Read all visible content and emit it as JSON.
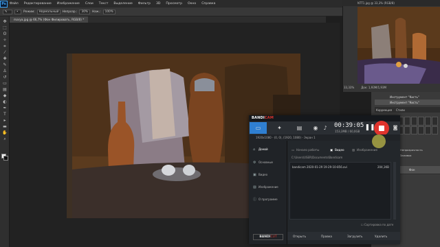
{
  "photoshop": {
    "logo": "Ps",
    "menu": [
      "Файл",
      "Редактирование",
      "Изображение",
      "Слои",
      "Текст",
      "Выделение",
      "Фильтр",
      "3D",
      "Просмотр",
      "Окно",
      "Справка"
    ],
    "options": {
      "mode_label": "Режим:",
      "mode_value": "Нормальный",
      "opacity_label": "Непрозр.:",
      "opacity_value": "30%",
      "flow_label": "Наж.:",
      "flow_value": "100%"
    },
    "doc_tab": "marya.jpg @ 66,7% (Фон Филировать, RGB/8) *",
    "navigator_title": "NTT1.jpg @ 33,3% (RGB/8)",
    "navigator_zoom": "33,33%",
    "navigator_doc": "Док: 1,93M/1,93M",
    "history": {
      "tab_correction": "Коррекция",
      "tab_styles": "Стили",
      "items": [
        "Инструмент \"Кисть\"",
        "Инструмент \"Кисть\"",
        "Инструмент \"Кисть\""
      ]
    },
    "layers": {
      "label_opacity": "Непрозрачность",
      "label_fill": "Заливка",
      "layer_names": [
        "Фон"
      ]
    }
  },
  "bandicam": {
    "logo_main": "BANDI",
    "logo_accent": "CAM",
    "timer": "00:39:05",
    "size": "153,3MB / 60,0GB",
    "info": "1920x1080 - (0, 0), (1920, 1080) - Экран 1",
    "nav": [
      "Домой",
      "Основные",
      "Видео",
      "Изображение",
      "О программе"
    ],
    "tabs": {
      "start": "Начало работы",
      "video": "Видео",
      "image": "Изображение"
    },
    "path": "C:\\Users\\USER\\Documents\\Bandicam",
    "file": {
      "name": "bandicam 2020-01-29 19-29-10-856.avi",
      "size": "204,1KB"
    },
    "sort_label": "Сортировка по дате",
    "bandicut_main": "BANDI",
    "bandicut_accent": "CUT",
    "bottom_buttons": [
      "Открыть",
      "Правка",
      "Загрузить",
      "Удалить"
    ]
  },
  "colors": {
    "record_red": "#e0342d",
    "accent_blue": "#3da5f6"
  }
}
